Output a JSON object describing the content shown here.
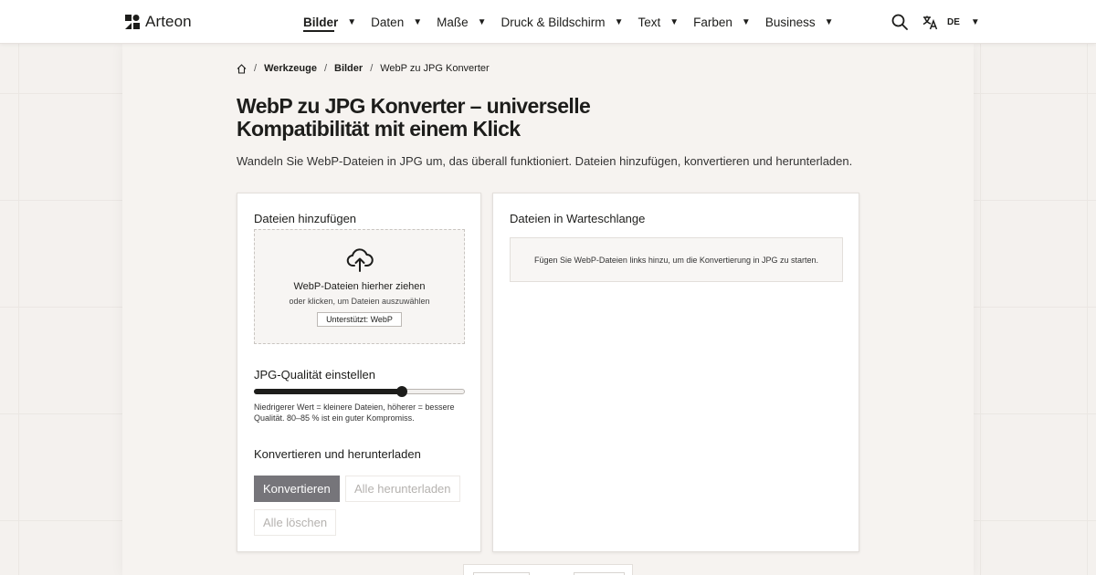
{
  "header": {
    "logo_text": "Arteon",
    "nav": [
      {
        "label": "Bilder",
        "active": true
      },
      {
        "label": "Daten"
      },
      {
        "label": "Maße"
      },
      {
        "label": "Druck & Bildschirm"
      },
      {
        "label": "Text"
      },
      {
        "label": "Farben"
      },
      {
        "label": "Business"
      }
    ],
    "caret": "▼",
    "language": "DE",
    "icons": {
      "search": "search-icon",
      "translate": "translate-icon",
      "home": "home-icon"
    }
  },
  "breadcrumb": {
    "sep": "/",
    "items": [
      "Werkzeuge",
      "Bilder",
      "WebP zu JPG Konverter"
    ]
  },
  "page": {
    "title": "WebP zu JPG Konverter – universelle Kompatibilität mit einem Klick",
    "subtitle": "Wandeln Sie WebP-Dateien in JPG um, das überall funktioniert. Dateien hinzufügen, konvertieren und herunterladen."
  },
  "add_panel": {
    "heading": "Dateien hinzufügen",
    "dropzone": {
      "icon": "cloud-upload-icon",
      "title": "WebP-Dateien hierher ziehen",
      "subtitle": "oder klicken, um Dateien auszuwählen",
      "badge": "Unterstützt: WebP"
    },
    "quality": {
      "heading": "JPG-Qualität einstellen",
      "value_fraction": 0.7,
      "hint": "Niedrigerer Wert = kleinere Dateien, höherer = bessere Qualität. 80–85 % ist ein guter Kompromiss."
    },
    "actions": {
      "heading": "Konvertieren und herunterladen",
      "convert": "Konvertieren",
      "download_all": "Alle herunterladen",
      "clear_all": "Alle löschen"
    }
  },
  "queue_panel": {
    "heading": "Dateien in Warteschlange",
    "empty_text": "Fügen Sie WebP-Dateien links hinzu, um die Konvertierung in JPG zu starten."
  },
  "colors": {
    "text": "#1d1d1b",
    "background": "#f4f1ee",
    "primary_button": "#76757a",
    "disabled_text": "#b5b2af"
  }
}
